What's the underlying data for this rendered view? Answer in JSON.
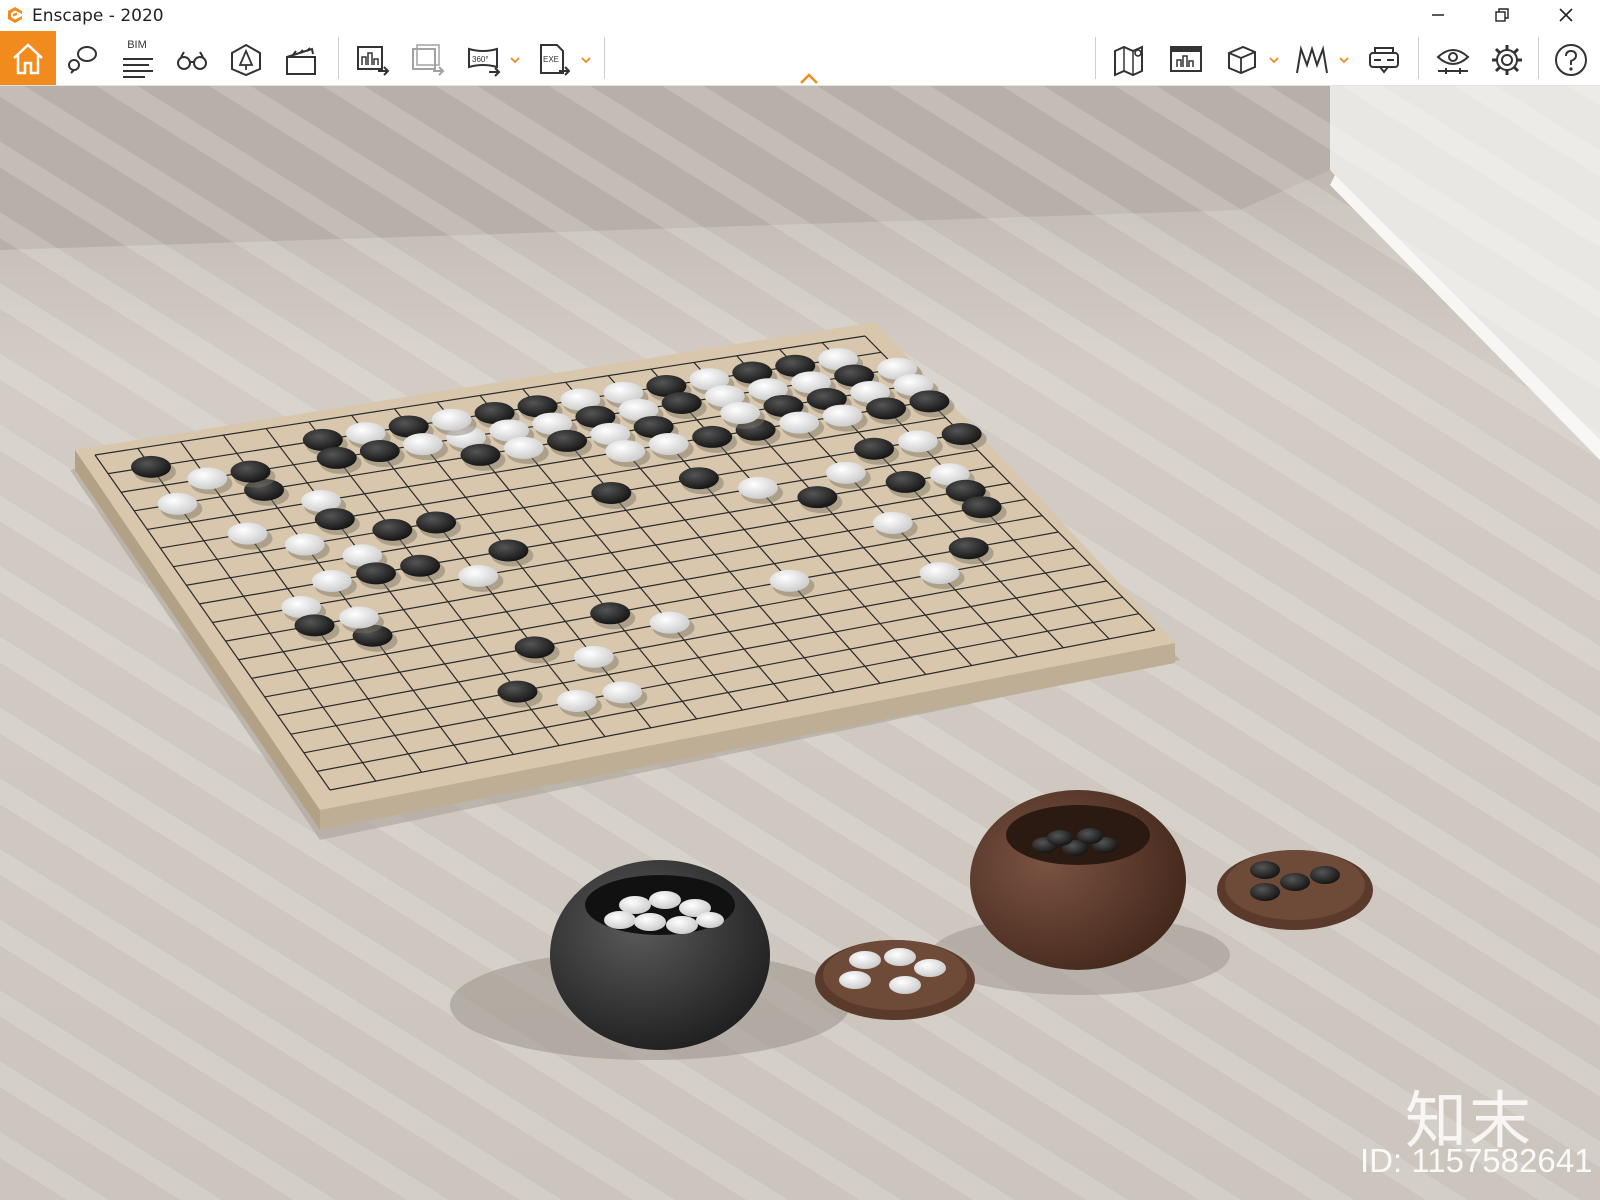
{
  "window": {
    "title": "Enscape - 2020",
    "accent_color": "#f28b1e"
  },
  "toolbar": {
    "bim_label": "BIM",
    "left_tools": [
      {
        "name": "home-icon",
        "active": true
      },
      {
        "name": "views-icon"
      },
      {
        "name": "bim-icon"
      },
      {
        "name": "binoculars-icon"
      },
      {
        "name": "asset-library-icon"
      },
      {
        "name": "video-editor-icon"
      },
      {
        "name": "export-image-icon"
      },
      {
        "name": "batch-render-icon"
      },
      {
        "name": "panorama-360-icon"
      },
      {
        "name": "export-exe-icon"
      }
    ],
    "panorama_label": "360°",
    "exe_label": "EXE",
    "right_tools": [
      {
        "name": "map-icon"
      },
      {
        "name": "web-standalone-icon"
      },
      {
        "name": "cube-icon"
      },
      {
        "name": "hills-icon"
      },
      {
        "name": "vr-headset-icon"
      },
      {
        "name": "visual-settings-icon"
      },
      {
        "name": "gear-icon"
      },
      {
        "name": "help-icon"
      }
    ]
  },
  "scene": {
    "description_objects": [
      "go-board",
      "black-stone-bowl",
      "white-stone-bowl",
      "bowl-lids",
      "window-blinds"
    ]
  },
  "watermark": {
    "brand": "知末",
    "image_id": "ID: 1157582641"
  }
}
